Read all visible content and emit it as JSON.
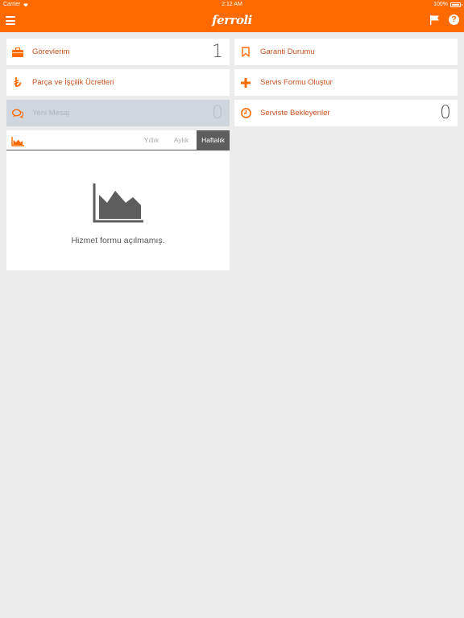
{
  "status": {
    "carrier": "Carrier",
    "time": "2:12 AM",
    "battery": "100%"
  },
  "app": {
    "title": "ferroli",
    "accent": "#ff6a00"
  },
  "tiles": {
    "tasks": {
      "label": "Görevlerim",
      "count": "1"
    },
    "warranty": {
      "label": "Garanti Durumu"
    },
    "fees": {
      "label": "Parça ve İşçilik Ücretleri"
    },
    "service_form": {
      "label": "Servis Formu Oluştur"
    },
    "new_message": {
      "label": "Yeni Mesaj",
      "count": "0"
    },
    "pending": {
      "label": "Serviste Bekleyenler",
      "count": "0"
    }
  },
  "chart": {
    "tabs": [
      "Yıllık",
      "Aylık",
      "Haftalık"
    ],
    "active_tab": "Haftalık",
    "empty_message": "Hizmet formu açılmamış."
  }
}
